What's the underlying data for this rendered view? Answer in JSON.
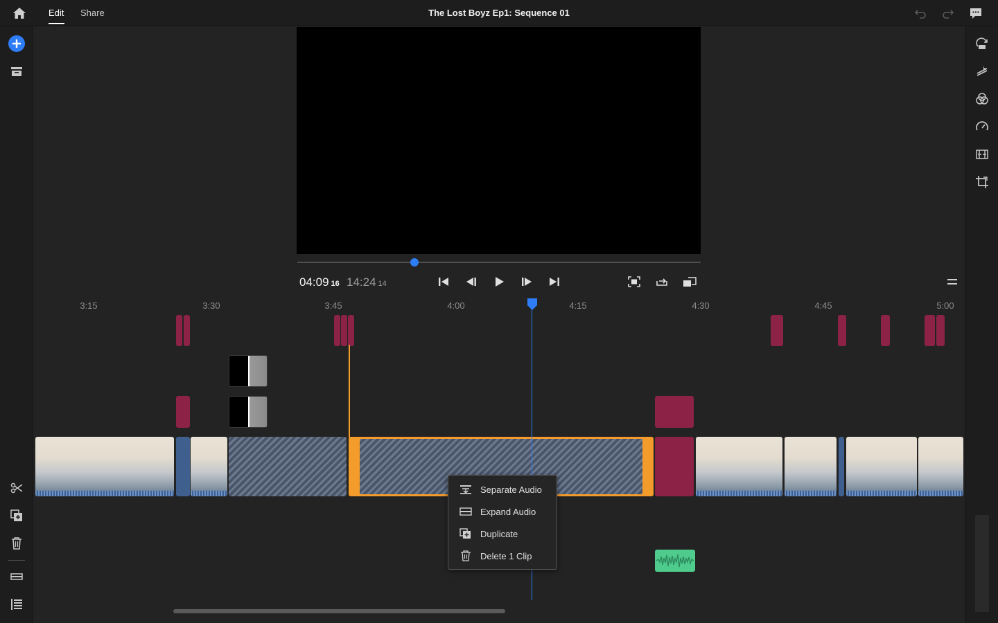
{
  "topbar": {
    "tabs": [
      {
        "label": "Edit"
      },
      {
        "label": "Share"
      }
    ],
    "title": "The Lost Boyz Ep1: Sequence 01"
  },
  "player": {
    "current_time": "04:09",
    "current_frames": "16",
    "duration": "14:24",
    "duration_frames": "14",
    "playhead_fraction": 0.29
  },
  "timeline": {
    "ruler": [
      "3:15",
      "3:30",
      "3:45",
      "4:00",
      "4:15",
      "4:30",
      "4:45",
      "5:00"
    ]
  },
  "context_menu": {
    "items": [
      {
        "label": "Separate Audio",
        "icon": "separate-audio-icon"
      },
      {
        "label": "Expand Audio",
        "icon": "expand-audio-icon"
      },
      {
        "label": "Duplicate",
        "icon": "duplicate-icon"
      },
      {
        "label": "Delete 1 Clip",
        "icon": "trash-icon"
      }
    ]
  },
  "colors": {
    "accent": "#2e7cf6",
    "selection": "#f39c2b",
    "marker": "#8c2347",
    "audio": "#4ecb8d"
  }
}
